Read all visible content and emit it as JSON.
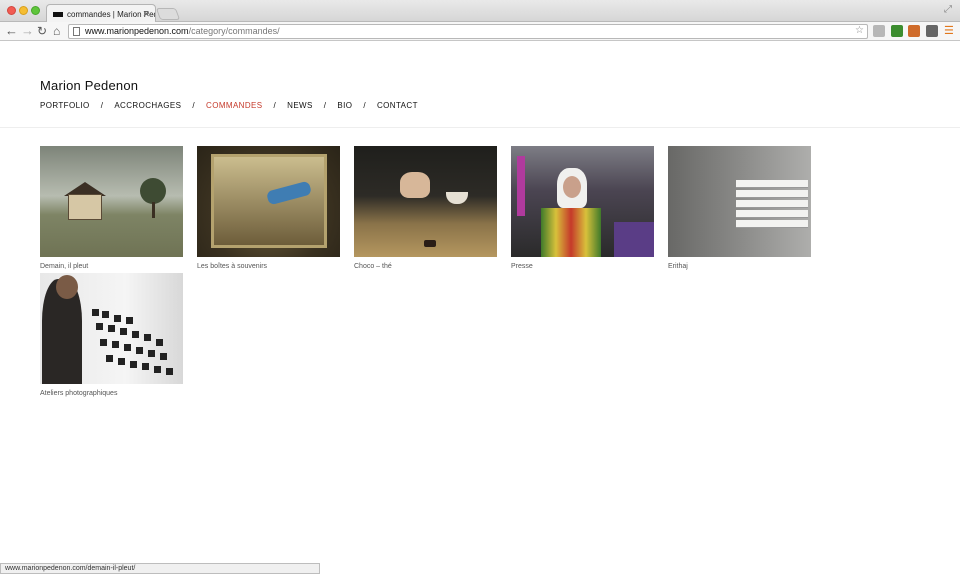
{
  "browser": {
    "tab_title": "commandes | Marion Pedenon",
    "url_host": "www.marionpedenon.com",
    "url_path": "/category/commandes/",
    "status_url": "www.marionpedenon.com/demain-il-pleut/"
  },
  "site": {
    "title": "Marion Pedenon"
  },
  "nav": {
    "items": [
      {
        "label": "PORTFOLIO"
      },
      {
        "label": "ACCROCHAGES"
      },
      {
        "label": "COMMANDES"
      },
      {
        "label": "NEWS"
      },
      {
        "label": "BIO"
      },
      {
        "label": "CONTACT"
      }
    ],
    "separator": "/",
    "active_color": "#c5392a"
  },
  "projects": [
    {
      "caption": "Demain, il pleut"
    },
    {
      "caption": "Les boîtes à souvenirs"
    },
    {
      "caption": "Choco – thé"
    },
    {
      "caption": "Presse"
    },
    {
      "caption": "Erithaj"
    },
    {
      "caption": "Ateliers photographiques"
    }
  ]
}
